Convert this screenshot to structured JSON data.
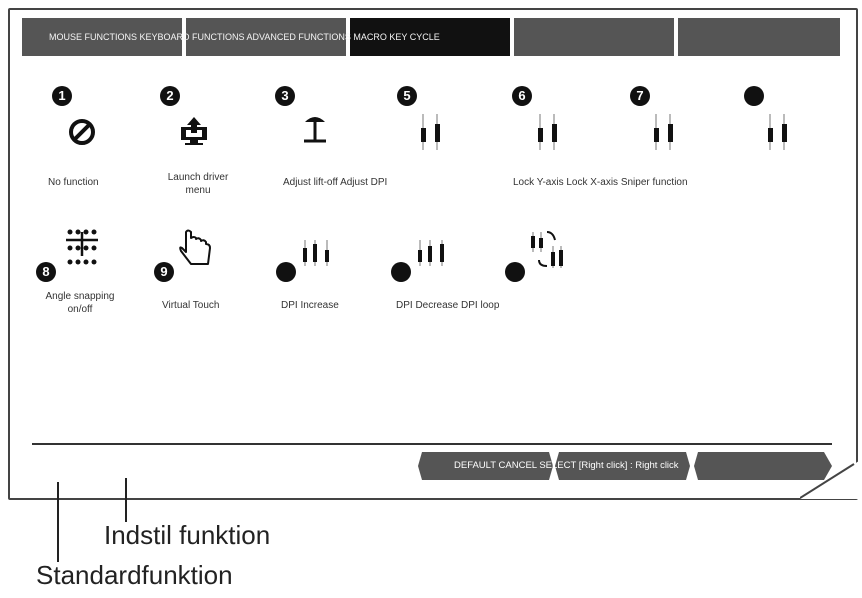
{
  "tabs": [
    {
      "label": "MOUSE FUNCTIONS KEYBOARD FUNCTIONS ADVANCED FUNCTIONS MACRO KEY CYCLE"
    }
  ],
  "row1": [
    {
      "num": "1",
      "icon": "no-entry-icon",
      "label": "No function"
    },
    {
      "num": "2",
      "icon": "launch-driver-icon",
      "label": "Launch driver menu"
    },
    {
      "num": "3",
      "icon": "lift-off-icon",
      "label": "Adjust lift-off Adjust DPI"
    },
    {
      "num": "5",
      "icon": "slider-icon",
      "label": ""
    },
    {
      "num": "6",
      "icon": "slider-icon",
      "label": "Lock Y-axis Lock X-axis Sniper function"
    },
    {
      "num": "7",
      "icon": "slider-icon",
      "label": ""
    },
    {
      "num": "",
      "icon": "slider-icon",
      "label": ""
    }
  ],
  "row2": [
    {
      "num": "8",
      "icon": "angle-snapping-icon",
      "label": "Angle snapping on/off"
    },
    {
      "num": "9",
      "icon": "hand-pointer-icon",
      "label": "Virtual Touch"
    },
    {
      "num": "",
      "icon": "dpi-increase-icon",
      "label": "DPI Increase"
    },
    {
      "num": "",
      "icon": "dpi-decrease-icon",
      "label": "DPI Decrease DPI loop"
    },
    {
      "num": "",
      "icon": "dpi-loop-icon",
      "label": ""
    }
  ],
  "footer": {
    "buttons_label": "DEFAULT CANCEL SELECT [Right click] : Right click"
  },
  "annotations": {
    "set_function": "Indstil funktion",
    "default_function": "Standardfunktion"
  }
}
